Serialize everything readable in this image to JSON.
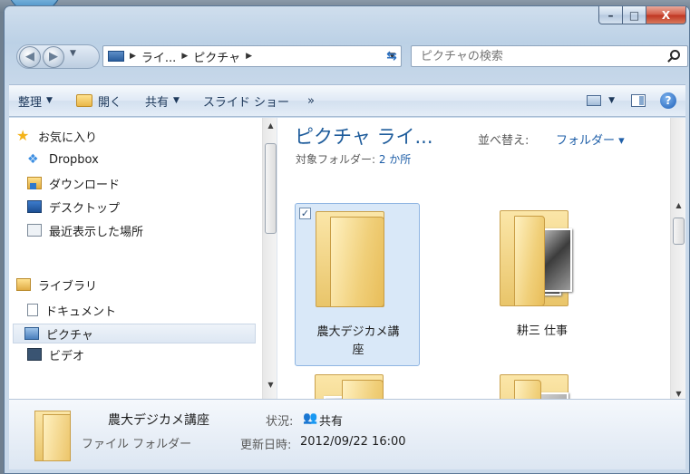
{
  "window": {
    "controls": {
      "minimize": "–",
      "maximize": "□",
      "close": "X"
    }
  },
  "address": {
    "crumbs": [
      "ライ...",
      "ピクチャ"
    ],
    "search_placeholder": "ピクチャの検索"
  },
  "toolbar": {
    "organize": "整理",
    "open": "開く",
    "share": "共有",
    "slideshow": "スライド ショー",
    "more": "»"
  },
  "nav": {
    "favorites": "お気に入り",
    "dropbox": "Dropbox",
    "downloads": "ダウンロード",
    "desktop": "デスクトップ",
    "recent": "最近表示した場所",
    "libraries": "ライブラリ",
    "documents": "ドキュメント",
    "pictures": "ピクチャ",
    "videos": "ビデオ"
  },
  "library": {
    "title": "ピクチャ ライ...",
    "subtitle_prefix": "対象フォルダー: ",
    "subtitle_link": "2 か所",
    "sort_label": "並べ替え:",
    "sort_value": "フォルダー ▾"
  },
  "folders": [
    {
      "name": "農大デジカメ講座",
      "selected": true,
      "checked": "✓"
    },
    {
      "name": "耕三 仕事",
      "selected": false
    }
  ],
  "details": {
    "name": "農大デジカメ講座",
    "type": "ファイル フォルダー",
    "status_label": "状況:",
    "status_value": "共有",
    "modified_label": "更新日時:",
    "modified_value": "2012/09/22 16:00"
  },
  "colors": {
    "accent": "#1e5c9b",
    "link": "#1f5fa8",
    "selection": "#d9e8f8"
  }
}
